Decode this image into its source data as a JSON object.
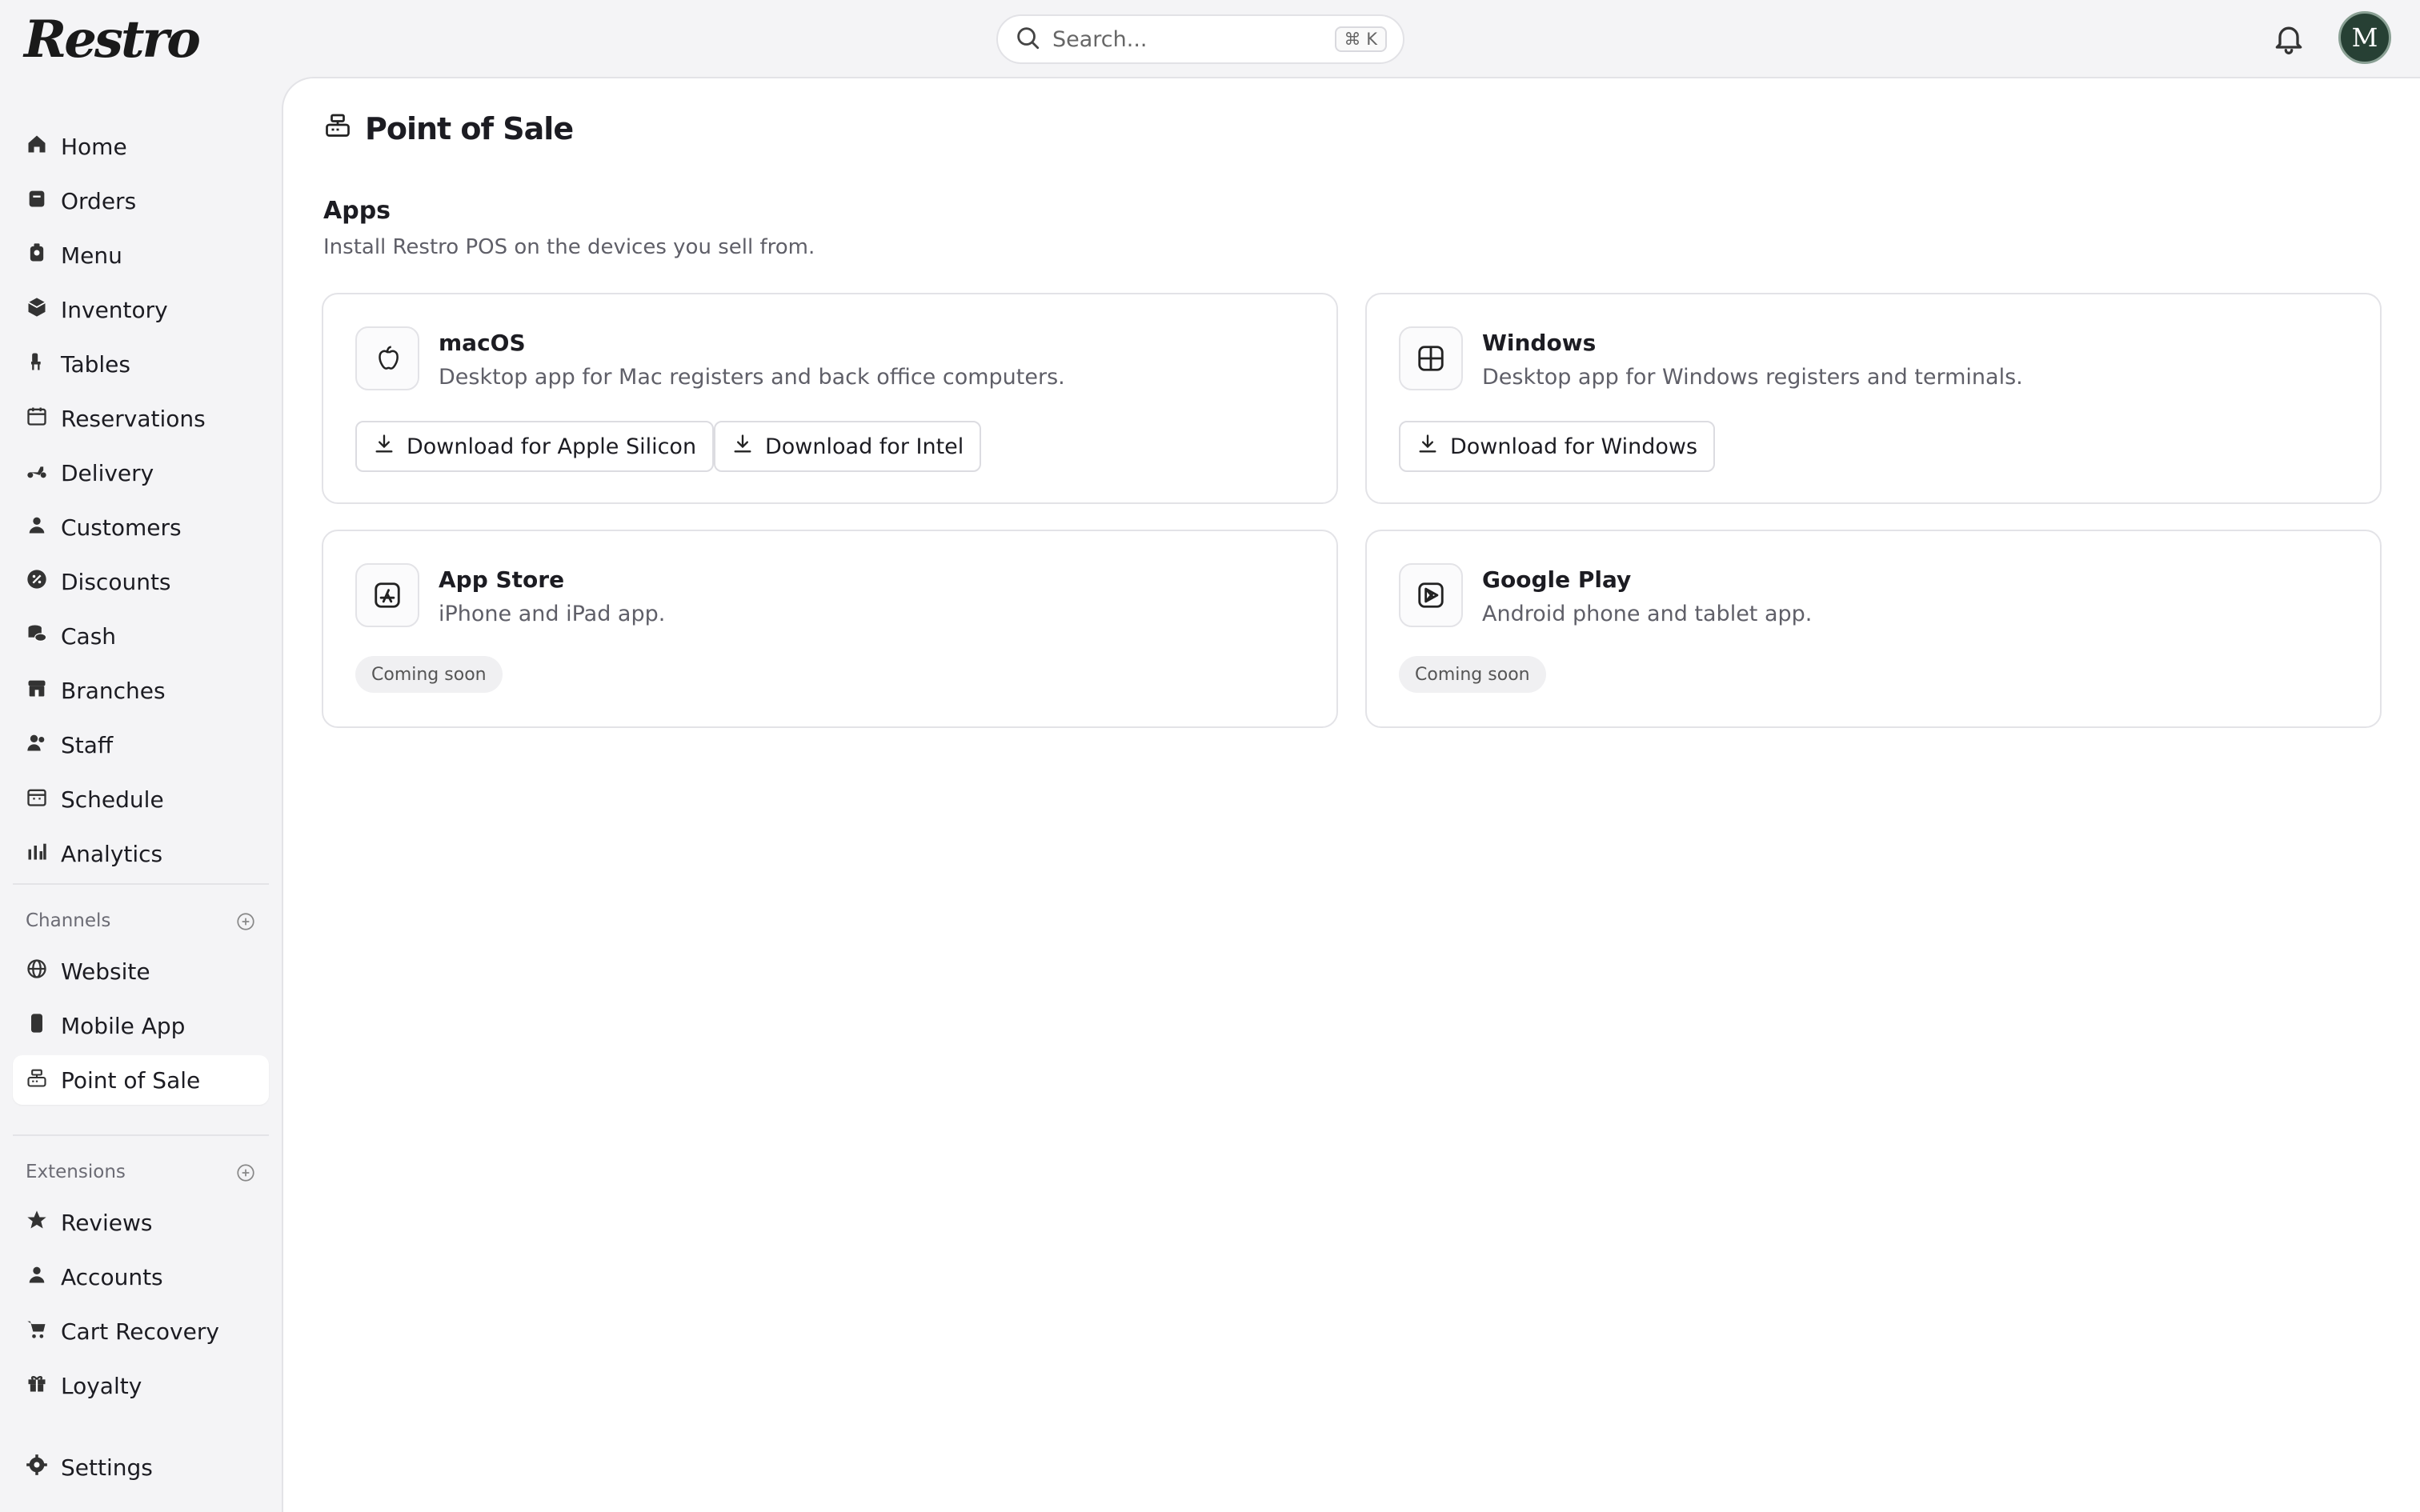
{
  "app": {
    "logo": "Restro",
    "avatar_initial": "M"
  },
  "search": {
    "placeholder": "Search...",
    "shortcut": "⌘ K"
  },
  "sidebar": {
    "items": [
      {
        "label": "Home",
        "icon": "home-icon"
      },
      {
        "label": "Orders",
        "icon": "orders-icon"
      },
      {
        "label": "Menu",
        "icon": "menu-icon"
      },
      {
        "label": "Inventory",
        "icon": "inventory-icon"
      },
      {
        "label": "Tables",
        "icon": "tables-icon"
      },
      {
        "label": "Reservations",
        "icon": "calendar-icon"
      },
      {
        "label": "Delivery",
        "icon": "scooter-icon"
      },
      {
        "label": "Customers",
        "icon": "user-icon"
      },
      {
        "label": "Discounts",
        "icon": "discount-icon"
      },
      {
        "label": "Cash",
        "icon": "cash-icon"
      },
      {
        "label": "Branches",
        "icon": "store-icon"
      },
      {
        "label": "Staff",
        "icon": "staff-icon"
      },
      {
        "label": "Schedule",
        "icon": "schedule-icon"
      },
      {
        "label": "Analytics",
        "icon": "chart-icon"
      }
    ],
    "channels_label": "Channels",
    "channels": [
      {
        "label": "Website",
        "icon": "globe-icon"
      },
      {
        "label": "Mobile App",
        "icon": "phone-icon"
      },
      {
        "label": "Point of Sale",
        "icon": "register-icon",
        "active": true
      }
    ],
    "extensions_label": "Extensions",
    "extensions": [
      {
        "label": "Reviews",
        "icon": "star-icon"
      },
      {
        "label": "Accounts",
        "icon": "user-icon"
      },
      {
        "label": "Cart Recovery",
        "icon": "cart-icon"
      },
      {
        "label": "Loyalty",
        "icon": "gift-icon"
      }
    ],
    "settings": {
      "label": "Settings",
      "icon": "gear-icon"
    }
  },
  "main": {
    "title": "Point of Sale",
    "section_title": "Apps",
    "section_sub": "Install Restro POS on the devices you sell from.",
    "cards": [
      {
        "title": "macOS",
        "desc": "Desktop app for Mac registers and back office computers.",
        "icon": "apple-icon",
        "buttons": [
          "Download for Apple Silicon",
          "Download for Intel"
        ]
      },
      {
        "title": "Windows",
        "desc": "Desktop app for Windows registers and terminals.",
        "icon": "windows-icon",
        "buttons": [
          "Download for Windows"
        ]
      },
      {
        "title": "App Store",
        "desc": "iPhone and iPad app.",
        "icon": "app-store-icon",
        "badge": "Coming soon"
      },
      {
        "title": "Google Play",
        "desc": "Android phone and tablet app.",
        "icon": "google-play-icon",
        "badge": "Coming soon"
      }
    ]
  },
  "colors": {
    "sidebar_bg": "#f4f4f6",
    "panel_bg": "#ffffff",
    "avatar_bg": "#274034",
    "text": "#1c1c22"
  }
}
